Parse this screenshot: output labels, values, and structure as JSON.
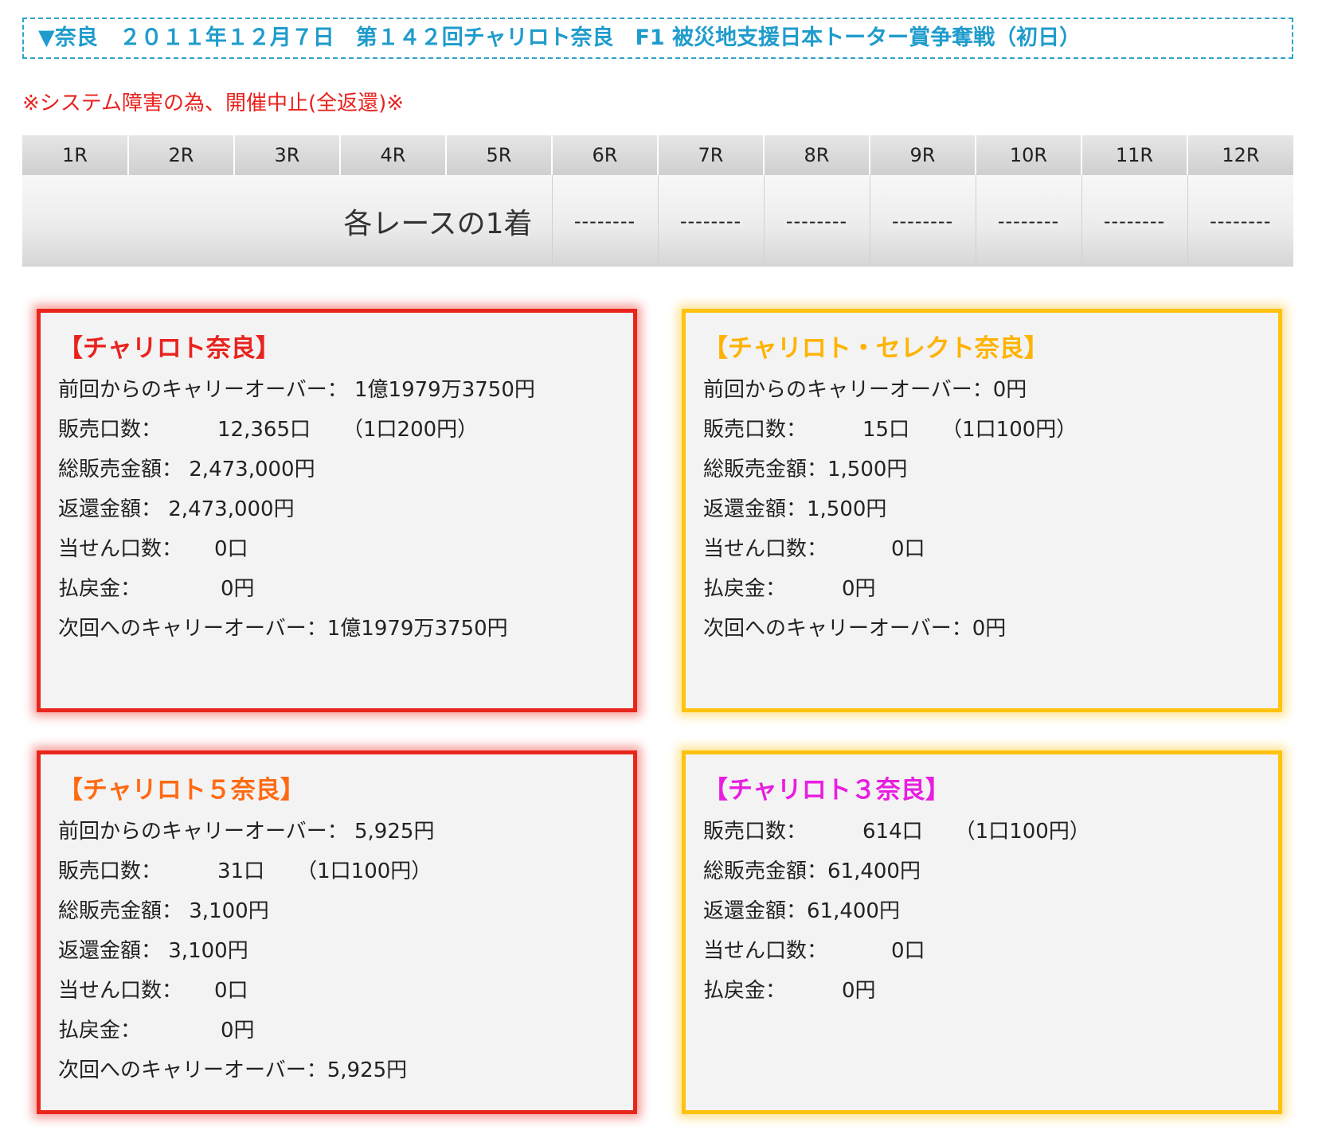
{
  "header": {
    "title": "▼奈良　２０１１年１２月７日　第１４２回チャリロト奈良　F1 被災地支援日本トーター賞争奪戦（初日）"
  },
  "notice": "※システム障害の為、開催中止(全返還)※",
  "race_table": {
    "races": [
      "1R",
      "2R",
      "3R",
      "4R",
      "5R",
      "6R",
      "7R",
      "8R",
      "9R",
      "10R",
      "11R",
      "12R"
    ],
    "label": "各レースの1着",
    "results": [
      "--------",
      "--------",
      "--------",
      "--------",
      "--------",
      "--------",
      "--------"
    ]
  },
  "boxes": {
    "charilot": {
      "title": "【チャリロト奈良】",
      "carryover_prev": "前回からのキャリーオーバー：  1億1979万3750円",
      "sales_label": "販売口数：",
      "sales_units": "12,365口",
      "sales_unit_price": "（1口200円）",
      "total_sales": "総販売金額：  2,473,000円",
      "refund": "返還金額：  2,473,000円",
      "winners_label": "当せん口数：",
      "winners": "0口",
      "payout_label": "払戻金：",
      "payout": "0円",
      "carryover_next": "次回へのキャリーオーバー：1億1979万3750円"
    },
    "select": {
      "title": "【チャリロト・セレクト奈良】",
      "carryover_prev": "前回からのキャリーオーバー：0円",
      "sales_label": "販売口数：",
      "sales_units": "15口",
      "sales_unit_price": "（1口100円）",
      "total_sales": "総販売金額：1,500円",
      "refund": "返還金額：1,500円",
      "winners_label": "当せん口数：",
      "winners": "0口",
      "payout_label": "払戻金：",
      "payout": "0円",
      "carryover_next": "次回へのキャリーオーバー：0円"
    },
    "charilot5": {
      "title": "【チャリロト５奈良】",
      "carryover_prev": "前回からのキャリーオーバー：  5,925円",
      "sales_label": "販売口数：",
      "sales_units": "31口",
      "sales_unit_price": "（1口100円）",
      "total_sales": "総販売金額：  3,100円",
      "refund": "返還金額：  3,100円",
      "winners_label": "当せん口数：",
      "winners": "0口",
      "payout_label": "払戻金：",
      "payout": "0円",
      "carryover_next": "次回へのキャリーオーバー：5,925円"
    },
    "charilot3": {
      "title": "【チャリロト３奈良】",
      "sales_label": "販売口数：",
      "sales_units": "614口",
      "sales_unit_price": "（1口100円）",
      "total_sales": "総販売金額：61,400円",
      "refund": "返還金額：61,400円",
      "winners_label": "当せん口数：",
      "winners": "0口",
      "payout_label": "払戻金：",
      "payout": "0円"
    }
  },
  "colors": {
    "header_text": "#1f9ccc",
    "notice": "#e8231e",
    "charilot_title": "#e8231e",
    "select_title": "#ffb300",
    "charilot5_title": "#ff6a13",
    "charilot3_title": "#e81ee0",
    "red_border": "#e8261c",
    "yellow_border": "#ffc20e"
  }
}
